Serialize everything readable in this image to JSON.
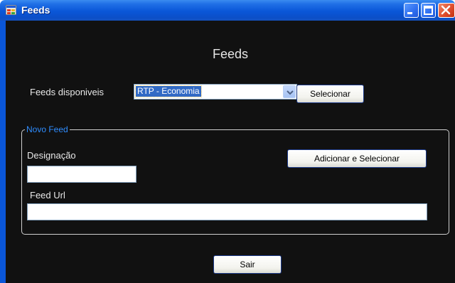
{
  "window": {
    "title": "Feeds"
  },
  "main": {
    "heading": "Feeds",
    "feeds_label": "Feeds disponiveis",
    "feeds_combo_value": "RTP - Economia",
    "select_button": "Selecionar",
    "new_feed_group": {
      "title": "Novo Feed",
      "designation_label": "Designação",
      "designation_value": "",
      "add_button": "Adicionar e Selecionar",
      "url_label": "Feed Url",
      "url_value": ""
    },
    "exit_button": "Sair"
  },
  "colors": {
    "titlebar": "#0a56d8",
    "client_bg": "#111111",
    "group_title": "#2f8dff",
    "selection": "#316ac5"
  }
}
